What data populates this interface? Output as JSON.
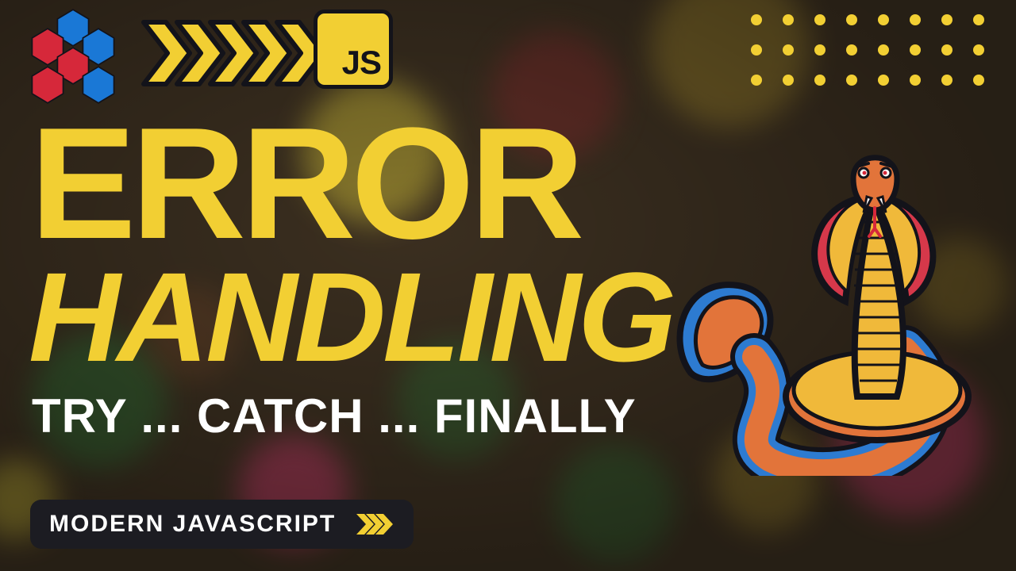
{
  "badge": {
    "js": "JS"
  },
  "title": {
    "line1": "ERROR",
    "line2": "HANDLING"
  },
  "subtitle": "TRY ... CATCH ... FINALLY",
  "footer": {
    "label": "MODERN JAVASCRIPT"
  },
  "colors": {
    "accent": "#f2cf33",
    "dark": "#13131a",
    "red": "#d6283a",
    "blue": "#1a78d6"
  },
  "icons": {
    "hex_logo": "hexagon-cluster",
    "chevrons": "chevron-right-stack",
    "js_badge": "javascript-logo",
    "snake": "cobra-snake",
    "dot_grid": "dot-grid"
  },
  "decor": {
    "chevron_count": 5,
    "dot_cols": 8,
    "dot_rows": 3,
    "mini_chevron_count": 3
  }
}
